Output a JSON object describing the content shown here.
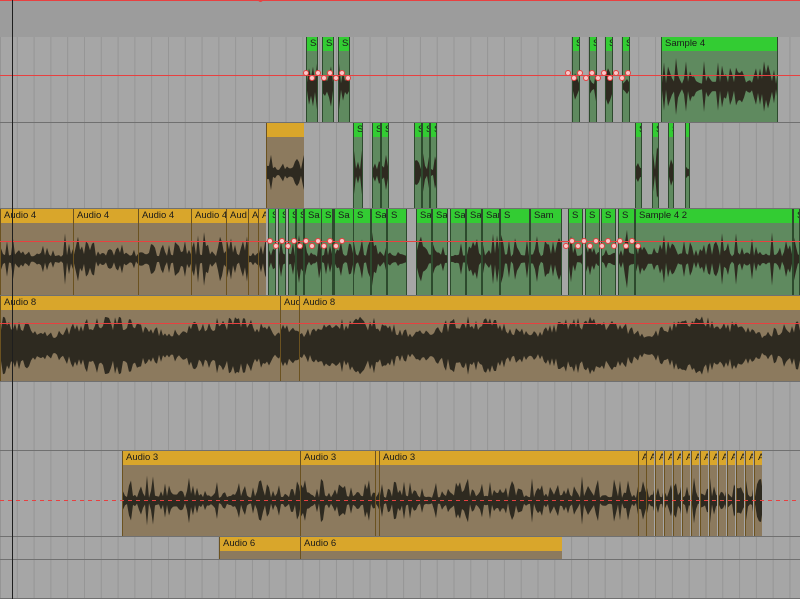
{
  "arrangement": {
    "tracks": [
      {
        "id": "t1",
        "clips": [
          {
            "label": "Sa",
            "color": "green"
          },
          {
            "label": "Sa",
            "color": "green"
          },
          {
            "label": "Sa",
            "color": "green"
          },
          {
            "label": "S",
            "color": "green"
          },
          {
            "label": "S",
            "color": "green"
          },
          {
            "label": "S",
            "color": "green"
          },
          {
            "label": "S",
            "color": "green"
          },
          {
            "label": "Sample 4",
            "color": "green"
          }
        ]
      },
      {
        "id": "t2",
        "clips": [
          {
            "label": "",
            "color": "gold"
          },
          {
            "label": "S",
            "color": "green"
          },
          {
            "label": "S",
            "color": "green"
          },
          {
            "label": "S",
            "color": "green"
          },
          {
            "label": "S",
            "color": "green"
          },
          {
            "label": "S",
            "color": "green"
          },
          {
            "label": "S",
            "color": "green"
          },
          {
            "label": "S",
            "color": "green"
          },
          {
            "label": "S",
            "color": "green"
          },
          {
            "label": "S",
            "color": "green"
          },
          {
            "label": "S",
            "color": "green"
          }
        ]
      },
      {
        "id": "t3",
        "clips": [
          {
            "label": "Audio 4",
            "color": "gold"
          },
          {
            "label": "Audio 4",
            "color": "gold"
          },
          {
            "label": "Audio 4",
            "color": "gold"
          },
          {
            "label": "Audio 4",
            "color": "gold"
          },
          {
            "label": "Aud",
            "color": "gold"
          },
          {
            "label": "A",
            "color": "gold"
          },
          {
            "label": "A",
            "color": "gold"
          },
          {
            "label": "S",
            "color": "green"
          },
          {
            "label": "S",
            "color": "green"
          },
          {
            "label": "S",
            "color": "green"
          },
          {
            "label": "S",
            "color": "green"
          },
          {
            "label": "Sa",
            "color": "green"
          },
          {
            "label": "S",
            "color": "green"
          },
          {
            "label": "Sa",
            "color": "green"
          },
          {
            "label": "S",
            "color": "green"
          },
          {
            "label": "Sa",
            "color": "green"
          },
          {
            "label": "S",
            "color": "green"
          },
          {
            "label": "Sa",
            "color": "green"
          },
          {
            "label": "Sa",
            "color": "green"
          },
          {
            "label": "Sa",
            "color": "green"
          },
          {
            "label": "Sa",
            "color": "green"
          },
          {
            "label": "Samp",
            "color": "green"
          },
          {
            "label": "S",
            "color": "green"
          },
          {
            "label": "Sam",
            "color": "green"
          },
          {
            "label": "S",
            "color": "green"
          },
          {
            "label": "S",
            "color": "green"
          },
          {
            "label": "S",
            "color": "green"
          },
          {
            "label": "S",
            "color": "green"
          },
          {
            "label": "Sample 4 2",
            "color": "green"
          },
          {
            "label": "S",
            "color": "green"
          }
        ]
      },
      {
        "id": "t4",
        "clips": [
          {
            "label": "Audio 8",
            "color": "gold"
          },
          {
            "label": "Audio 8",
            "color": "gold"
          },
          {
            "label": "Audio 8",
            "color": "gold"
          }
        ]
      },
      {
        "id": "t5",
        "clips": []
      },
      {
        "id": "t6",
        "clips": [
          {
            "label": "Audio 3",
            "color": "gold"
          },
          {
            "label": "Audio 3",
            "color": "gold"
          },
          {
            "label": "A",
            "color": "gold"
          },
          {
            "label": "Audio 3",
            "color": "gold"
          },
          {
            "label": "A",
            "color": "gold"
          },
          {
            "label": "A",
            "color": "gold"
          },
          {
            "label": "A",
            "color": "gold"
          },
          {
            "label": "A",
            "color": "gold"
          },
          {
            "label": "A",
            "color": "gold"
          },
          {
            "label": "A",
            "color": "gold"
          },
          {
            "label": "A",
            "color": "gold"
          },
          {
            "label": "A",
            "color": "gold"
          },
          {
            "label": "A",
            "color": "gold"
          },
          {
            "label": "A",
            "color": "gold"
          },
          {
            "label": "A",
            "color": "gold"
          },
          {
            "label": "A",
            "color": "gold"
          },
          {
            "label": "A",
            "color": "gold"
          },
          {
            "label": "A",
            "color": "gold"
          }
        ]
      },
      {
        "id": "t7",
        "clips": [
          {
            "label": "Audio 6",
            "color": "gold"
          },
          {
            "label": "Audio 6",
            "color": "gold"
          }
        ]
      },
      {
        "id": "t8",
        "clips": []
      }
    ],
    "colors": {
      "green_header": "#33cc33",
      "green_body": "#5f8a5f",
      "gold_header": "#d9a62b",
      "gold_body": "#8c7a5e",
      "automation": "#e84040",
      "waveform": "#2e2a20",
      "track_bg": "#a6a6a6"
    }
  }
}
